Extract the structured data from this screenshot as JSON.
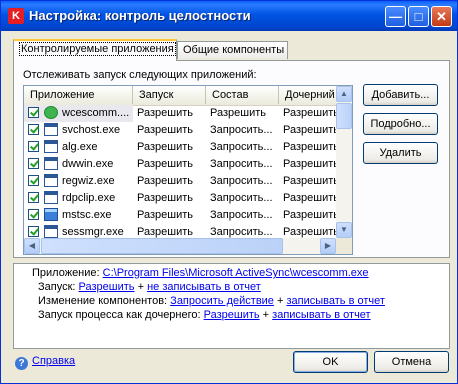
{
  "window": {
    "title": "Настройка: контроль целостности",
    "app_icon_letter": "K"
  },
  "tabs": [
    {
      "label": "Контролируемые приложения",
      "active": true
    },
    {
      "label": "Общие компоненты",
      "active": false
    }
  ],
  "list_label": "Отслеживать запуск следующих приложений:",
  "columns": [
    "Приложение",
    "Запуск",
    "Состав",
    "Дочерний"
  ],
  "rows": [
    {
      "name": "wcescomm....",
      "launch": "Разрешить",
      "composition": "Разрешить",
      "child": "Разрешить",
      "icon": "activesync-icon",
      "checked": true
    },
    {
      "name": "svchost.exe",
      "launch": "Разрешить",
      "composition": "Запросить...",
      "child": "Разрешить",
      "icon": "exe-icon",
      "checked": true
    },
    {
      "name": "alg.exe",
      "launch": "Разрешить",
      "composition": "Запросить...",
      "child": "Разрешить",
      "icon": "exe-icon",
      "checked": true
    },
    {
      "name": "dwwin.exe",
      "launch": "Разрешить",
      "composition": "Запросить...",
      "child": "Разрешить",
      "icon": "exe-icon",
      "checked": true
    },
    {
      "name": "regwiz.exe",
      "launch": "Разрешить",
      "composition": "Запросить...",
      "child": "Разрешить",
      "icon": "exe-icon",
      "checked": true
    },
    {
      "name": "rdpclip.exe",
      "launch": "Разрешить",
      "composition": "Запросить...",
      "child": "Разрешить",
      "icon": "exe-icon",
      "checked": true
    },
    {
      "name": "mstsc.exe",
      "launch": "Разрешить",
      "composition": "Запросить...",
      "child": "Разрешить",
      "icon": "remote-desktop-icon",
      "checked": true
    },
    {
      "name": "sessmgr.exe",
      "launch": "Разрешить",
      "composition": "Запросить...",
      "child": "Разрешить",
      "icon": "exe-icon",
      "checked": true
    }
  ],
  "buttons": {
    "add": "Добавить...",
    "details": "Подробно...",
    "delete": "Удалить",
    "ok": "OK",
    "cancel": "Отмена"
  },
  "info": {
    "app_label": "Приложение:",
    "app_path": "C:\\Program Files\\Microsoft ActiveSync\\wcescomm.exe",
    "launch_label": "Запуск:",
    "launch_action": "Разрешить",
    "launch_log": "не записывать в отчет",
    "change_label": "Изменение компонентов:",
    "change_action": "Запросить действие",
    "change_log": "записывать в отчет",
    "child_label": "Запуск процесса как дочернего:",
    "child_action": "Разрешить",
    "child_log": "записывать в отчет",
    "plus": "+"
  },
  "help_label": "Справка"
}
